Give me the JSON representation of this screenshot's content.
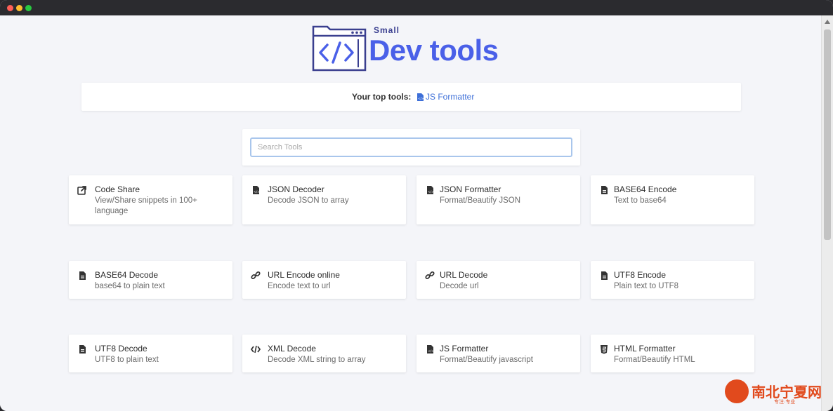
{
  "window": {
    "title": ""
  },
  "logo": {
    "small": "Small",
    "main": "Dev tools"
  },
  "top_tools": {
    "label": "Your top tools:",
    "link": "JS Formatter"
  },
  "search": {
    "placeholder": "Search Tools",
    "value": ""
  },
  "tools": [
    {
      "icon": "share-icon",
      "title": "Code Share",
      "desc": "View/Share snippets in 100+ language"
    },
    {
      "icon": "file-code-icon",
      "title": "JSON Decoder",
      "desc": "Decode JSON to array"
    },
    {
      "icon": "file-code-icon",
      "title": "JSON Formatter",
      "desc": "Format/Beautify JSON"
    },
    {
      "icon": "file-icon",
      "title": "BASE64 Encode",
      "desc": "Text to base64"
    },
    {
      "icon": "file-icon",
      "title": "BASE64 Decode",
      "desc": "base64 to plain text"
    },
    {
      "icon": "link-icon",
      "title": "URL Encode online",
      "desc": "Encode text to url"
    },
    {
      "icon": "link-icon",
      "title": "URL Decode",
      "desc": "Decode url"
    },
    {
      "icon": "file-icon",
      "title": "UTF8 Encode",
      "desc": "Plain text to UTF8"
    },
    {
      "icon": "file-icon",
      "title": "UTF8 Decode",
      "desc": "UTF8 to plain text"
    },
    {
      "icon": "code-icon",
      "title": "XML Decode",
      "desc": "Decode XML string to array"
    },
    {
      "icon": "file-code-icon",
      "title": "JS Formatter",
      "desc": "Format/Beautify javascript"
    },
    {
      "icon": "html5-icon",
      "title": "HTML Formatter",
      "desc": "Format/Beautify HTML"
    }
  ],
  "watermark": {
    "text": "南北宁夏网",
    "sub": "专注·专业"
  },
  "colors": {
    "accent": "#4a60e8",
    "link": "#3d6fd8",
    "background": "#f4f5f9",
    "card": "#ffffff"
  }
}
